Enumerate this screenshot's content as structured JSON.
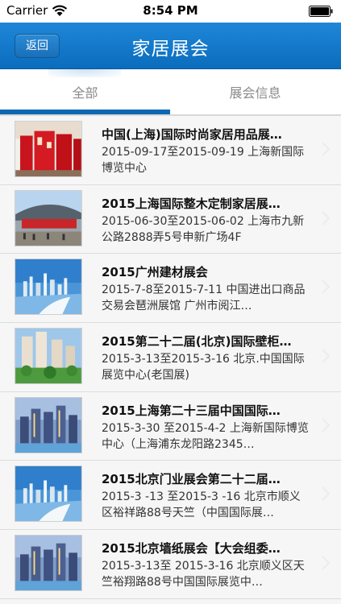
{
  "status_bar": {
    "carrier": "Carrier",
    "time": "8:54 PM"
  },
  "nav": {
    "back_label": "返回",
    "title": "家居展会"
  },
  "tabs": [
    {
      "label": "全部",
      "selected": true
    },
    {
      "label": "展会信息",
      "selected": false
    }
  ],
  "colors": {
    "nav_blue": "#0b6cbd",
    "tab_indicator": "#0d68b3"
  },
  "items": [
    {
      "title": "中国(上海)国际时尚家居用品展…",
      "desc": "2015-09-17至2015-09-19 上海新国际博览中心",
      "thumb": "red-chairs"
    },
    {
      "title": "2015上海国际整木定制家居展…",
      "desc": "2015-06-30至2015-06-02 上海市九新公路2888弄5号申新广场4F",
      "thumb": "exhibition-hall"
    },
    {
      "title": "2015广州建材展会",
      "desc": "2015-7-8至2015-7-11 中国进出口商品交易会琶洲展馆 广州市阅江…",
      "thumb": "city-skyline"
    },
    {
      "title": "2015第二十二届(北京)国际壁柜…",
      "desc": "2015-3-13至2015-3-16 北京.中国国际展览中心(老国展)",
      "thumb": "residential-towers"
    },
    {
      "title": "2015上海第二十三届中国国际…",
      "desc": "2015-3-30 至2015-4-2 上海新国际博览中心（上海浦东龙阳路2345…",
      "thumb": "night-towers"
    },
    {
      "title": "2015北京门业展会第二十二届…",
      "desc": "2015-3 -13 至2015-3 -16 北京市顺义区裕祥路88号天竺（中国国际展…",
      "thumb": "city-skyline"
    },
    {
      "title": "2015北京墙纸展会【大会组委…",
      "desc": "2015-3-13至 2015-3-16 北京顺义区天竺裕翔路88号中国国际展览中…",
      "thumb": "night-towers"
    }
  ]
}
